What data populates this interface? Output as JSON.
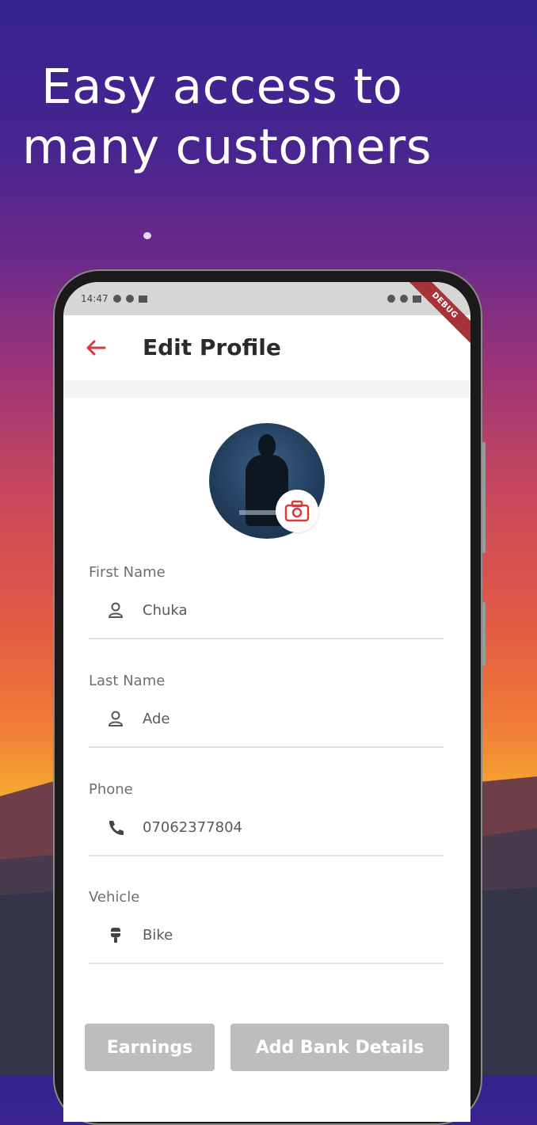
{
  "headline": {
    "line1": "Easy access to",
    "line2": "many customers"
  },
  "phone": {
    "status_bar": {
      "time": "14:47",
      "ribbon": "DEBUG"
    },
    "app_bar": {
      "back_icon": "arrow-left-icon",
      "title": "Edit Profile"
    },
    "avatar": {
      "camera_icon": "camera-icon"
    },
    "fields": [
      {
        "label": "First Name",
        "icon": "person-icon",
        "value": "Chuka"
      },
      {
        "label": "Last Name",
        "icon": "person-icon",
        "value": "Ade"
      },
      {
        "label": "Phone",
        "icon": "phone-icon",
        "value": "07062377804"
      },
      {
        "label": "Vehicle",
        "icon": "bike-icon",
        "value": "Bike"
      }
    ],
    "buttons": {
      "earnings": "Earnings",
      "add_bank": "Add Bank Details"
    }
  },
  "colors": {
    "accent": "#d63a3a",
    "button_disabled": "#bdbdbd",
    "ribbon": "#a7323a"
  }
}
